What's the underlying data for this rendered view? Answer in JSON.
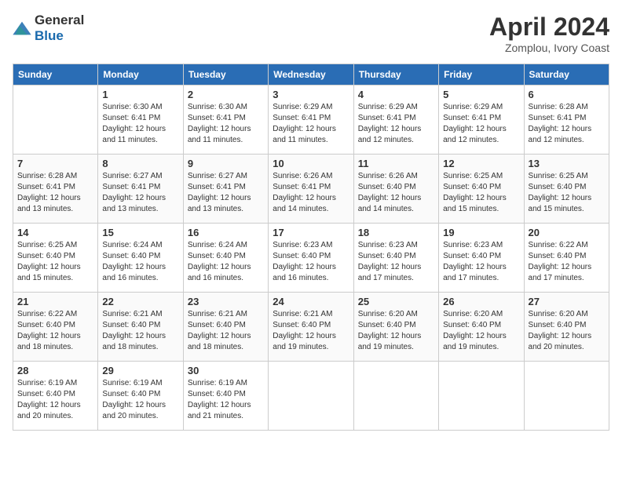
{
  "header": {
    "logo_general": "General",
    "logo_blue": "Blue",
    "month_year": "April 2024",
    "location": "Zomplou, Ivory Coast"
  },
  "weekdays": [
    "Sunday",
    "Monday",
    "Tuesday",
    "Wednesday",
    "Thursday",
    "Friday",
    "Saturday"
  ],
  "weeks": [
    [
      {
        "day": "",
        "sunrise": "",
        "sunset": "",
        "daylight": ""
      },
      {
        "day": "1",
        "sunrise": "Sunrise: 6:30 AM",
        "sunset": "Sunset: 6:41 PM",
        "daylight": "Daylight: 12 hours and 11 minutes."
      },
      {
        "day": "2",
        "sunrise": "Sunrise: 6:30 AM",
        "sunset": "Sunset: 6:41 PM",
        "daylight": "Daylight: 12 hours and 11 minutes."
      },
      {
        "day": "3",
        "sunrise": "Sunrise: 6:29 AM",
        "sunset": "Sunset: 6:41 PM",
        "daylight": "Daylight: 12 hours and 11 minutes."
      },
      {
        "day": "4",
        "sunrise": "Sunrise: 6:29 AM",
        "sunset": "Sunset: 6:41 PM",
        "daylight": "Daylight: 12 hours and 12 minutes."
      },
      {
        "day": "5",
        "sunrise": "Sunrise: 6:29 AM",
        "sunset": "Sunset: 6:41 PM",
        "daylight": "Daylight: 12 hours and 12 minutes."
      },
      {
        "day": "6",
        "sunrise": "Sunrise: 6:28 AM",
        "sunset": "Sunset: 6:41 PM",
        "daylight": "Daylight: 12 hours and 12 minutes."
      }
    ],
    [
      {
        "day": "7",
        "sunrise": "Sunrise: 6:28 AM",
        "sunset": "Sunset: 6:41 PM",
        "daylight": "Daylight: 12 hours and 13 minutes."
      },
      {
        "day": "8",
        "sunrise": "Sunrise: 6:27 AM",
        "sunset": "Sunset: 6:41 PM",
        "daylight": "Daylight: 12 hours and 13 minutes."
      },
      {
        "day": "9",
        "sunrise": "Sunrise: 6:27 AM",
        "sunset": "Sunset: 6:41 PM",
        "daylight": "Daylight: 12 hours and 13 minutes."
      },
      {
        "day": "10",
        "sunrise": "Sunrise: 6:26 AM",
        "sunset": "Sunset: 6:41 PM",
        "daylight": "Daylight: 12 hours and 14 minutes."
      },
      {
        "day": "11",
        "sunrise": "Sunrise: 6:26 AM",
        "sunset": "Sunset: 6:40 PM",
        "daylight": "Daylight: 12 hours and 14 minutes."
      },
      {
        "day": "12",
        "sunrise": "Sunrise: 6:25 AM",
        "sunset": "Sunset: 6:40 PM",
        "daylight": "Daylight: 12 hours and 15 minutes."
      },
      {
        "day": "13",
        "sunrise": "Sunrise: 6:25 AM",
        "sunset": "Sunset: 6:40 PM",
        "daylight": "Daylight: 12 hours and 15 minutes."
      }
    ],
    [
      {
        "day": "14",
        "sunrise": "Sunrise: 6:25 AM",
        "sunset": "Sunset: 6:40 PM",
        "daylight": "Daylight: 12 hours and 15 minutes."
      },
      {
        "day": "15",
        "sunrise": "Sunrise: 6:24 AM",
        "sunset": "Sunset: 6:40 PM",
        "daylight": "Daylight: 12 hours and 16 minutes."
      },
      {
        "day": "16",
        "sunrise": "Sunrise: 6:24 AM",
        "sunset": "Sunset: 6:40 PM",
        "daylight": "Daylight: 12 hours and 16 minutes."
      },
      {
        "day": "17",
        "sunrise": "Sunrise: 6:23 AM",
        "sunset": "Sunset: 6:40 PM",
        "daylight": "Daylight: 12 hours and 16 minutes."
      },
      {
        "day": "18",
        "sunrise": "Sunrise: 6:23 AM",
        "sunset": "Sunset: 6:40 PM",
        "daylight": "Daylight: 12 hours and 17 minutes."
      },
      {
        "day": "19",
        "sunrise": "Sunrise: 6:23 AM",
        "sunset": "Sunset: 6:40 PM",
        "daylight": "Daylight: 12 hours and 17 minutes."
      },
      {
        "day": "20",
        "sunrise": "Sunrise: 6:22 AM",
        "sunset": "Sunset: 6:40 PM",
        "daylight": "Daylight: 12 hours and 17 minutes."
      }
    ],
    [
      {
        "day": "21",
        "sunrise": "Sunrise: 6:22 AM",
        "sunset": "Sunset: 6:40 PM",
        "daylight": "Daylight: 12 hours and 18 minutes."
      },
      {
        "day": "22",
        "sunrise": "Sunrise: 6:21 AM",
        "sunset": "Sunset: 6:40 PM",
        "daylight": "Daylight: 12 hours and 18 minutes."
      },
      {
        "day": "23",
        "sunrise": "Sunrise: 6:21 AM",
        "sunset": "Sunset: 6:40 PM",
        "daylight": "Daylight: 12 hours and 18 minutes."
      },
      {
        "day": "24",
        "sunrise": "Sunrise: 6:21 AM",
        "sunset": "Sunset: 6:40 PM",
        "daylight": "Daylight: 12 hours and 19 minutes."
      },
      {
        "day": "25",
        "sunrise": "Sunrise: 6:20 AM",
        "sunset": "Sunset: 6:40 PM",
        "daylight": "Daylight: 12 hours and 19 minutes."
      },
      {
        "day": "26",
        "sunrise": "Sunrise: 6:20 AM",
        "sunset": "Sunset: 6:40 PM",
        "daylight": "Daylight: 12 hours and 19 minutes."
      },
      {
        "day": "27",
        "sunrise": "Sunrise: 6:20 AM",
        "sunset": "Sunset: 6:40 PM",
        "daylight": "Daylight: 12 hours and 20 minutes."
      }
    ],
    [
      {
        "day": "28",
        "sunrise": "Sunrise: 6:19 AM",
        "sunset": "Sunset: 6:40 PM",
        "daylight": "Daylight: 12 hours and 20 minutes."
      },
      {
        "day": "29",
        "sunrise": "Sunrise: 6:19 AM",
        "sunset": "Sunset: 6:40 PM",
        "daylight": "Daylight: 12 hours and 20 minutes."
      },
      {
        "day": "30",
        "sunrise": "Sunrise: 6:19 AM",
        "sunset": "Sunset: 6:40 PM",
        "daylight": "Daylight: 12 hours and 21 minutes."
      },
      {
        "day": "",
        "sunrise": "",
        "sunset": "",
        "daylight": ""
      },
      {
        "day": "",
        "sunrise": "",
        "sunset": "",
        "daylight": ""
      },
      {
        "day": "",
        "sunrise": "",
        "sunset": "",
        "daylight": ""
      },
      {
        "day": "",
        "sunrise": "",
        "sunset": "",
        "daylight": ""
      }
    ]
  ]
}
